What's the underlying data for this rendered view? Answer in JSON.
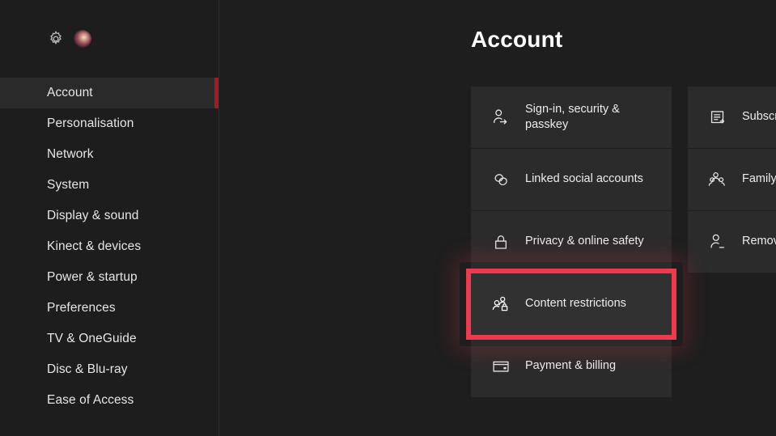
{
  "sidebar": {
    "header": {
      "gear_icon": "gear-icon",
      "avatar_icon": "user-avatar"
    },
    "items": [
      {
        "label": "Account",
        "selected": true
      },
      {
        "label": "Personalisation",
        "selected": false
      },
      {
        "label": "Network",
        "selected": false
      },
      {
        "label": "System",
        "selected": false
      },
      {
        "label": "Display & sound",
        "selected": false
      },
      {
        "label": "Kinect & devices",
        "selected": false
      },
      {
        "label": "Power & startup",
        "selected": false
      },
      {
        "label": "Preferences",
        "selected": false
      },
      {
        "label": "TV & OneGuide",
        "selected": false
      },
      {
        "label": "Disc & Blu-ray",
        "selected": false
      },
      {
        "label": "Ease of Access",
        "selected": false
      }
    ]
  },
  "main": {
    "title": "Account",
    "columns": [
      {
        "tiles": [
          {
            "label": "Sign-in, security & passkey",
            "icon": "person-arrow-icon",
            "focused": false
          },
          {
            "label": "Linked social accounts",
            "icon": "link-chain-icon",
            "focused": false
          },
          {
            "label": "Privacy & online safety",
            "icon": "lock-icon",
            "focused": false
          },
          {
            "label": "Content restrictions",
            "icon": "people-lock-icon",
            "focused": true
          },
          {
            "label": "Payment & billing",
            "icon": "credit-card-icon",
            "focused": false
          }
        ]
      },
      {
        "tiles": [
          {
            "label": "Subscriptions",
            "icon": "document-list-icon",
            "focused": false
          },
          {
            "label": "Family settings",
            "icon": "people-group-icon",
            "focused": false
          },
          {
            "label": "Remove accounts",
            "icon": "person-minus-icon",
            "focused": false
          }
        ]
      }
    ]
  },
  "colors": {
    "background": "#1e1e1e",
    "tile": "#2b2b2b",
    "focus_outline": "#ee3a4f",
    "sidebar_accent": "#a51b22",
    "selected_row": "#2a2a2a",
    "text": "#ececec"
  }
}
